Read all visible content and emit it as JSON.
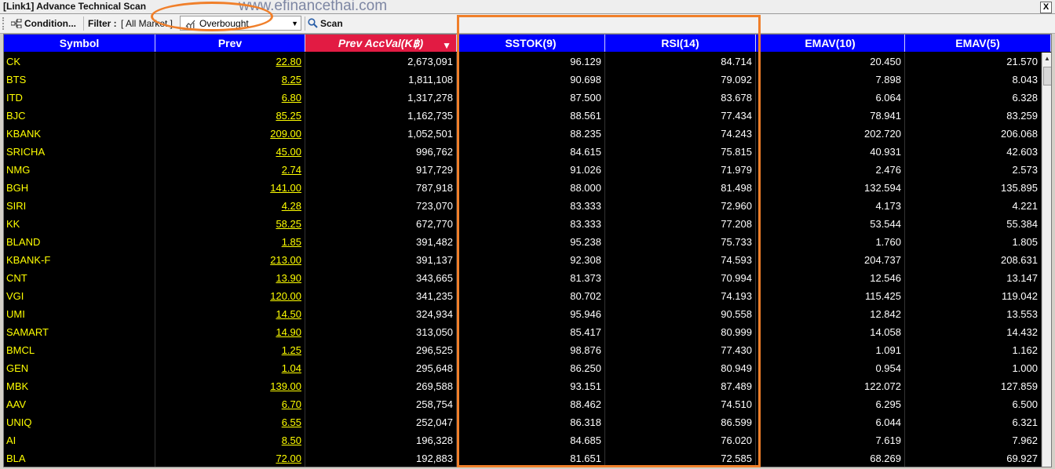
{
  "window": {
    "title": "[Link1] Advance Technical Scan",
    "watermark": "www.efinancethai.com",
    "close_label": "X"
  },
  "toolbar": {
    "condition_label": "Condition...",
    "filter_label": "Filter :",
    "filter_value": "[ All Market ]",
    "scan_preset": "Overbought",
    "scan_label": "Scan"
  },
  "columns": [
    "Symbol",
    "Prev",
    "Prev AccVal(K฿)",
    "SSTOK(9)",
    "RSI(14)",
    "EMAV(10)",
    "EMAV(5)"
  ],
  "sorted_column": "Prev AccVal(K฿)",
  "rows": [
    {
      "symbol": "CK",
      "prev": "22.80",
      "accval": "2,673,091",
      "sstok": "96.129",
      "rsi": "84.714",
      "emav10": "20.450",
      "emav5": "21.570"
    },
    {
      "symbol": "BTS",
      "prev": "8.25",
      "accval": "1,811,108",
      "sstok": "90.698",
      "rsi": "79.092",
      "emav10": "7.898",
      "emav5": "8.043"
    },
    {
      "symbol": "ITD",
      "prev": "6.80",
      "accval": "1,317,278",
      "sstok": "87.500",
      "rsi": "83.678",
      "emav10": "6.064",
      "emav5": "6.328"
    },
    {
      "symbol": "BJC",
      "prev": "85.25",
      "accval": "1,162,735",
      "sstok": "88.561",
      "rsi": "77.434",
      "emav10": "78.941",
      "emav5": "83.259"
    },
    {
      "symbol": "KBANK",
      "prev": "209.00",
      "accval": "1,052,501",
      "sstok": "88.235",
      "rsi": "74.243",
      "emav10": "202.720",
      "emav5": "206.068"
    },
    {
      "symbol": "SRICHA",
      "prev": "45.00",
      "accval": "996,762",
      "sstok": "84.615",
      "rsi": "75.815",
      "emav10": "40.931",
      "emav5": "42.603"
    },
    {
      "symbol": "NMG",
      "prev": "2.74",
      "accval": "917,729",
      "sstok": "91.026",
      "rsi": "71.979",
      "emav10": "2.476",
      "emav5": "2.573"
    },
    {
      "symbol": "BGH",
      "prev": "141.00",
      "accval": "787,918",
      "sstok": "88.000",
      "rsi": "81.498",
      "emav10": "132.594",
      "emav5": "135.895"
    },
    {
      "symbol": "SIRI",
      "prev": "4.28",
      "accval": "723,070",
      "sstok": "83.333",
      "rsi": "72.960",
      "emav10": "4.173",
      "emav5": "4.221"
    },
    {
      "symbol": "KK",
      "prev": "58.25",
      "accval": "672,770",
      "sstok": "83.333",
      "rsi": "77.208",
      "emav10": "53.544",
      "emav5": "55.384"
    },
    {
      "symbol": "BLAND",
      "prev": "1.85",
      "accval": "391,482",
      "sstok": "95.238",
      "rsi": "75.733",
      "emav10": "1.760",
      "emav5": "1.805"
    },
    {
      "symbol": "KBANK-F",
      "prev": "213.00",
      "accval": "391,137",
      "sstok": "92.308",
      "rsi": "74.593",
      "emav10": "204.737",
      "emav5": "208.631"
    },
    {
      "symbol": "CNT",
      "prev": "13.90",
      "accval": "343,665",
      "sstok": "81.373",
      "rsi": "70.994",
      "emav10": "12.546",
      "emav5": "13.147"
    },
    {
      "symbol": "VGI",
      "prev": "120.00",
      "accval": "341,235",
      "sstok": "80.702",
      "rsi": "74.193",
      "emav10": "115.425",
      "emav5": "119.042"
    },
    {
      "symbol": "UMI",
      "prev": "14.50",
      "accval": "324,934",
      "sstok": "95.946",
      "rsi": "90.558",
      "emav10": "12.842",
      "emav5": "13.553"
    },
    {
      "symbol": "SAMART",
      "prev": "14.90",
      "accval": "313,050",
      "sstok": "85.417",
      "rsi": "80.999",
      "emav10": "14.058",
      "emav5": "14.432"
    },
    {
      "symbol": "BMCL",
      "prev": "1.25",
      "accval": "296,525",
      "sstok": "98.876",
      "rsi": "77.430",
      "emav10": "1.091",
      "emav5": "1.162"
    },
    {
      "symbol": "GEN",
      "prev": "1.04",
      "accval": "295,648",
      "sstok": "86.250",
      "rsi": "80.949",
      "emav10": "0.954",
      "emav5": "1.000"
    },
    {
      "symbol": "MBK",
      "prev": "139.00",
      "accval": "269,588",
      "sstok": "93.151",
      "rsi": "87.489",
      "emav10": "122.072",
      "emav5": "127.859"
    },
    {
      "symbol": "AAV",
      "prev": "6.70",
      "accval": "258,754",
      "sstok": "88.462",
      "rsi": "74.510",
      "emav10": "6.295",
      "emav5": "6.500"
    },
    {
      "symbol": "UNIQ",
      "prev": "6.55",
      "accval": "252,047",
      "sstok": "86.318",
      "rsi": "86.599",
      "emav10": "6.044",
      "emav5": "6.321"
    },
    {
      "symbol": "AI",
      "prev": "8.50",
      "accval": "196,328",
      "sstok": "84.685",
      "rsi": "76.020",
      "emav10": "7.619",
      "emav5": "7.962"
    },
    {
      "symbol": "BLA",
      "prev": "72.00",
      "accval": "192,883",
      "sstok": "81.651",
      "rsi": "72.585",
      "emav10": "68.269",
      "emav5": "69.927"
    }
  ],
  "colors": {
    "header_bg": "#0000ff",
    "sorted_header_bg": "#e21b43",
    "grid_bg": "#000000",
    "symbol_text": "#ffff00",
    "annotation": "#f07f2a"
  }
}
